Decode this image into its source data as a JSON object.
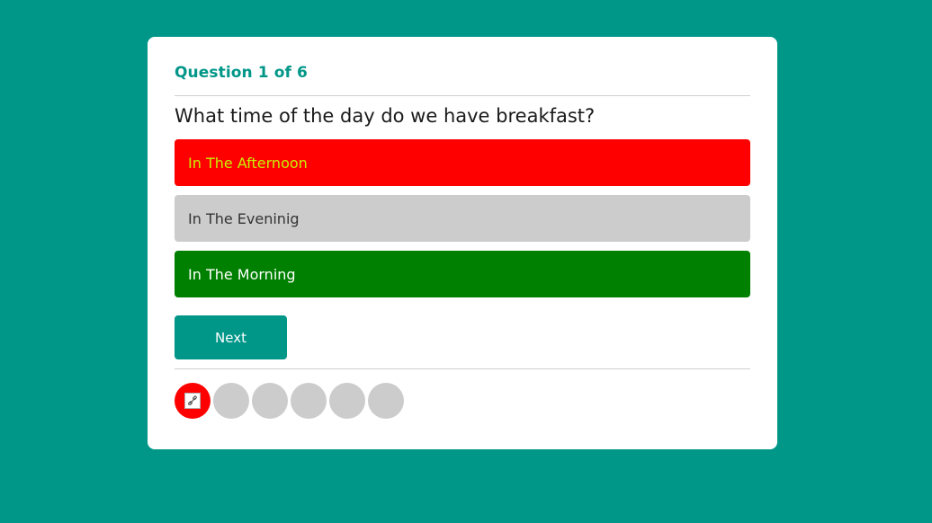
{
  "quiz": {
    "counter": "Question 1 of 6",
    "question": "What time of the day do we have breakfast?",
    "options": [
      {
        "label": "In The Afternoon",
        "state": "wrong"
      },
      {
        "label": "In The Eveninig",
        "state": "neutral"
      },
      {
        "label": "In The Morning",
        "state": "correct"
      }
    ],
    "next_label": "Next",
    "progress": [
      {
        "state": "wrong",
        "icon": "broken-image-icon"
      },
      {
        "state": "pending"
      },
      {
        "state": "pending"
      },
      {
        "state": "pending"
      },
      {
        "state": "pending"
      },
      {
        "state": "pending"
      }
    ]
  },
  "colors": {
    "background": "#009688",
    "accent": "#009688",
    "wrong": "#ff0000",
    "correct": "#008000",
    "neutral": "#cccccc"
  }
}
